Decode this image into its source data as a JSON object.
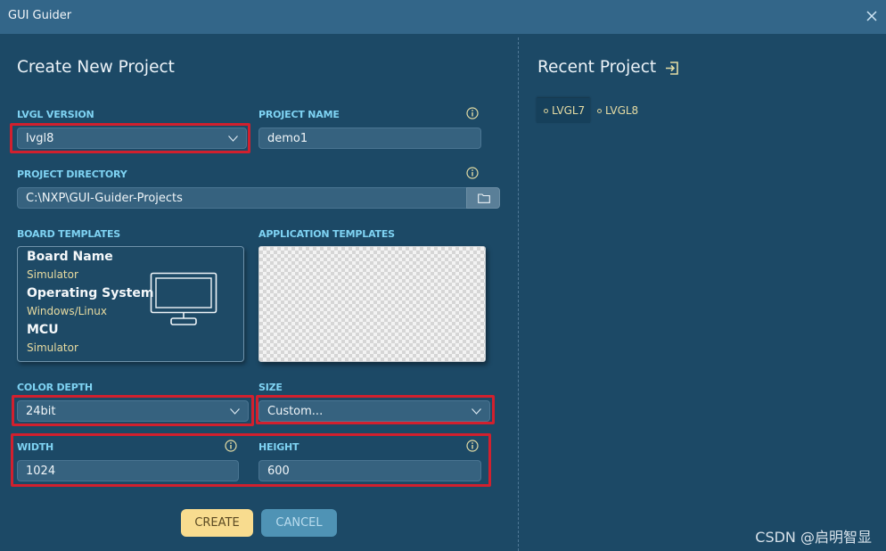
{
  "window": {
    "title": "GUI Guider"
  },
  "create_project": {
    "heading": "Create New Project",
    "lvgl_version": {
      "label": "LVGL VERSION",
      "value": "lvgl8"
    },
    "project_name": {
      "label": "PROJECT NAME",
      "value": "demo1"
    },
    "project_directory": {
      "label": "PROJECT DIRECTORY",
      "value": "C:\\NXP\\GUI-Guider-Projects"
    },
    "board_templates": {
      "label": "BOARD TEMPLATES",
      "card": {
        "board_name_label": "Board Name",
        "board_name_value": "Simulator",
        "os_label": "Operating System",
        "os_value": "Windows/Linux",
        "mcu_label": "MCU",
        "mcu_value": "Simulator"
      }
    },
    "application_templates": {
      "label": "APPLICATION TEMPLATES"
    },
    "color_depth": {
      "label": "COLOR DEPTH",
      "value": "24bit"
    },
    "size": {
      "label": "SIZE",
      "value": "Custom..."
    },
    "width": {
      "label": "WIDTH",
      "value": "1024"
    },
    "height": {
      "label": "HEIGHT",
      "value": "600"
    },
    "buttons": {
      "create": "CREATE",
      "cancel": "CANCEL"
    }
  },
  "recent_project": {
    "heading": "Recent Project",
    "tabs": [
      {
        "label": "LVGL7",
        "active": true
      },
      {
        "label": "LVGL8",
        "active": false
      }
    ]
  },
  "watermark": "CSDN @启明智显",
  "colors": {
    "background": "#1c4966",
    "titlebar": "#336689",
    "label_accent": "#7fd3f3",
    "highlight_box": "#d1202e",
    "create_button": "#f8dc8f",
    "cancel_button": "#4f93b5"
  }
}
